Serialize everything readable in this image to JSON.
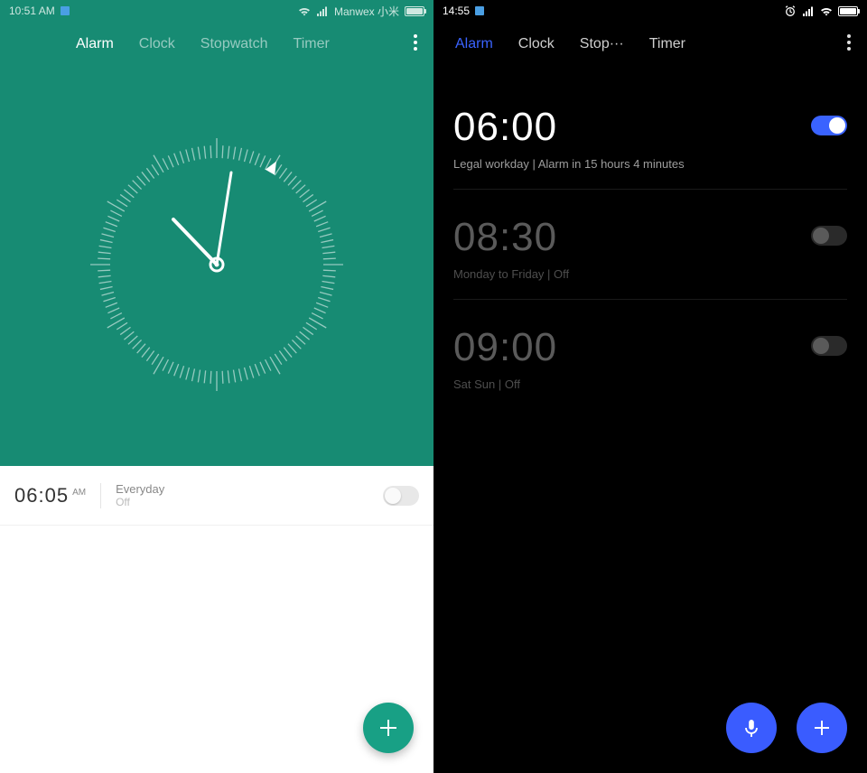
{
  "left": {
    "status": {
      "time": "10:51 AM",
      "carrier": "Manwex  小米"
    },
    "tabs": [
      "Alarm",
      "Clock",
      "Stopwatch",
      "Timer"
    ],
    "active_tab": 0,
    "alarm": {
      "time": "06:05",
      "ampm": "AM",
      "repeat": "Everyday",
      "state": "Off"
    }
  },
  "right": {
    "status": {
      "time": "14:55"
    },
    "tabs": [
      "Alarm",
      "Clock",
      "Stop···",
      "Timer"
    ],
    "active_tab": 0,
    "alarms": [
      {
        "time": "06:00",
        "sub": "Legal workday  |  Alarm in 15 hours 4 minutes",
        "on": true
      },
      {
        "time": "08:30",
        "sub": "Monday to Friday  |  Off",
        "on": false
      },
      {
        "time": "09:00",
        "sub": "Sat Sun  |  Off",
        "on": false
      }
    ]
  }
}
